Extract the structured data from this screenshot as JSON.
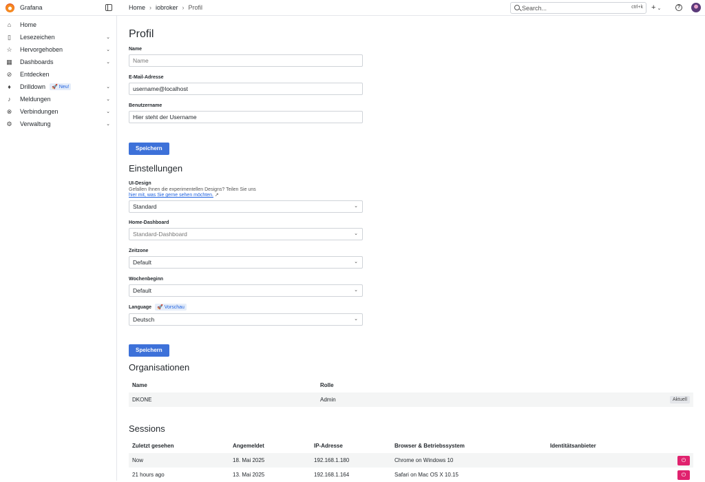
{
  "topbar": {
    "brand": "Grafana",
    "breadcrumb": [
      "Home",
      "iobroker",
      "Profil"
    ],
    "search_placeholder": "Search...",
    "search_shortcut": "ctrl+k",
    "plus_label": "+"
  },
  "sidebar": {
    "items": [
      {
        "label": "Home",
        "icon": "home-icon"
      },
      {
        "label": "Lesezeichen",
        "icon": "bookmark-icon"
      },
      {
        "label": "Hervorgehoben",
        "icon": "star-icon"
      },
      {
        "label": "Dashboards",
        "icon": "apps-icon"
      },
      {
        "label": "Entdecken",
        "icon": "compass-icon"
      },
      {
        "label": "Drilldown",
        "icon": "microphone-icon",
        "badge": "Neu!"
      },
      {
        "label": "Meldungen",
        "icon": "bell-icon"
      },
      {
        "label": "Verbindungen",
        "icon": "link-icon"
      },
      {
        "label": "Verwaltung",
        "icon": "cog-icon"
      }
    ]
  },
  "profile": {
    "title": "Profil",
    "name_label": "Name",
    "name_placeholder": "Name",
    "email_label": "E-Mail-Adresse",
    "email_value": "username@localhost",
    "username_label": "Benutzername",
    "username_value": "Hier steht der Username",
    "save_label": "Speichern"
  },
  "settings": {
    "title": "Einstellungen",
    "ui_design_label": "UI-Design",
    "ui_design_desc": "Gefallen Ihnen die experimentellen Designs? Teilen Sie uns",
    "ui_design_link": "hier mit, was Sie gerne sehen möchten.",
    "ui_design_value": "Standard",
    "home_dashboard_label": "Home-Dashboard",
    "home_dashboard_value": "Standard-Dashboard",
    "timezone_label": "Zeitzone",
    "timezone_value": "Default",
    "week_start_label": "Wochenbeginn",
    "week_start_value": "Default",
    "language_label": "Language",
    "language_badge": "Vorschau",
    "language_value": "Deutsch",
    "save_label": "Speichern"
  },
  "organizations": {
    "title": "Organisationen",
    "headers": [
      "Name",
      "Rolle"
    ],
    "rows": [
      {
        "name": "DKONE",
        "role": "Admin",
        "status": "Aktuell"
      }
    ]
  },
  "sessions": {
    "title": "Sessions",
    "headers": [
      "Zuletzt gesehen",
      "Angemeldet",
      "IP-Adresse",
      "Browser & Betriebssystem",
      "Identitätsanbieter"
    ],
    "rows": [
      {
        "last_seen": "Now",
        "logged_in": "18. Mai 2025",
        "ip": "192.168.1.180",
        "browser": "Chrome on Windows 10",
        "provider": ""
      },
      {
        "last_seen": "21 hours ago",
        "logged_in": "13. Mai 2025",
        "ip": "192.168.1.164",
        "browser": "Safari on Mac OS X 10.15",
        "provider": ""
      }
    ]
  },
  "colors": {
    "primary": "#3d71d9",
    "danger": "#e0226e",
    "accent": "#f58a1f"
  }
}
